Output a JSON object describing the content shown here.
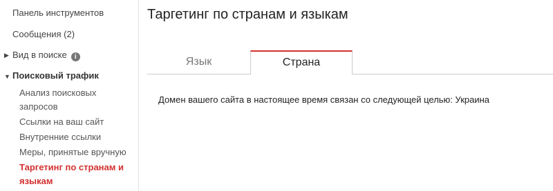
{
  "sidebar": {
    "dashboard": "Панель инструментов",
    "messages": "Сообщения (2)",
    "search_appearance": "Вид в поиске",
    "search_traffic": "Поисковый трафик",
    "subitems": [
      "Анализ поисковых запросов",
      "Ссылки на ваш сайт",
      "Внутренние ссылки",
      "Меры, принятые вручную",
      "Таргетинг по странам и языкам"
    ]
  },
  "main": {
    "title": "Таргетинг по странам и языкам",
    "tabs": [
      {
        "label": "Язык"
      },
      {
        "label": "Страна"
      }
    ],
    "content": "Домен вашего сайта в настоящее время связан со следующей целью: Украина"
  },
  "colors": {
    "accent": "#d32f2f"
  }
}
